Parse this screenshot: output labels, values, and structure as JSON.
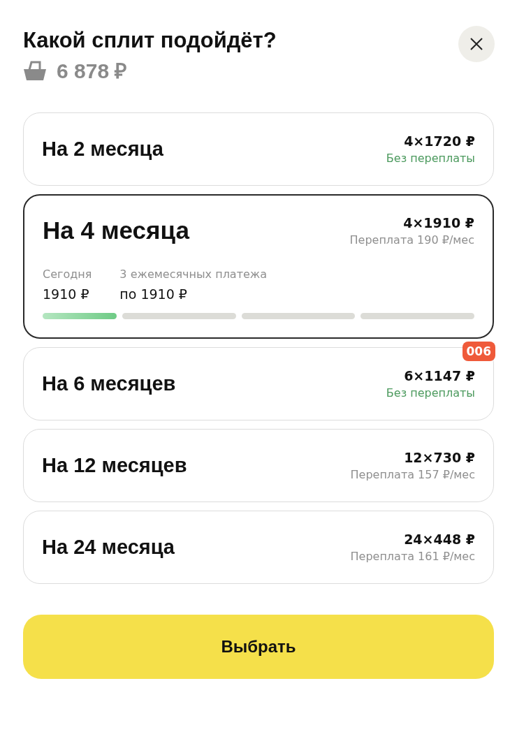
{
  "header": {
    "title": "Какой сплит подойдёт?",
    "total": "6 878 ₽"
  },
  "options": [
    {
      "title": "На 2 месяца",
      "payment": "4×1720 ₽",
      "note": "Без переплаты",
      "overpay": false,
      "selected": false
    },
    {
      "title": "На 4 месяца",
      "payment": "4×1910 ₽",
      "note": "Переплата 190 ₽/мес",
      "overpay": true,
      "selected": true,
      "schedule": {
        "today_label": "Сегодня",
        "today_value": "1910 ₽",
        "rest_label": "3 ежемесячных платежа",
        "rest_value": "по 1910 ₽",
        "segments": [
          {
            "paid": true
          },
          {
            "paid": false
          },
          {
            "paid": false
          },
          {
            "paid": false
          }
        ]
      }
    },
    {
      "title": "На 6 месяцев",
      "payment": "6×1147 ₽",
      "note": "Без переплаты",
      "overpay": false,
      "selected": false,
      "badge": "006"
    },
    {
      "title": "На 12 месяцев",
      "payment": "12×730 ₽",
      "note": "Переплата 157 ₽/мес",
      "overpay": true,
      "selected": false
    },
    {
      "title": "На 24 месяца",
      "payment": "24×448 ₽",
      "note": "Переплата 161 ₽/мес",
      "overpay": true,
      "selected": false
    }
  ],
  "button": "Выбрать"
}
